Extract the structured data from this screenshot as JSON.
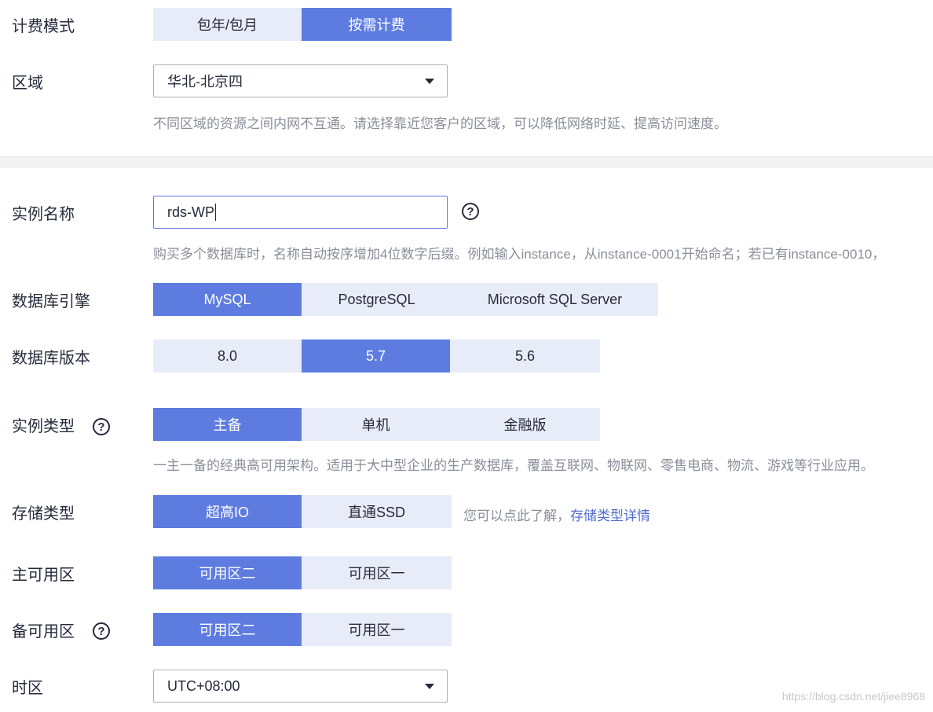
{
  "billing": {
    "label": "计费模式",
    "options": [
      "包年/包月",
      "按需计费"
    ],
    "selected": 1
  },
  "region": {
    "label": "区域",
    "value": "华北-北京四",
    "hint": "不同区域的资源之间内网不互通。请选择靠近您客户的区域，可以降低网络时延、提高访问速度。"
  },
  "instance_name": {
    "label": "实例名称",
    "value": "rds-WP",
    "hint": "购买多个数据库时，名称自动按序增加4位数字后缀。例如输入instance，从instance-0001开始命名；若已有instance-0010，"
  },
  "db_engine": {
    "label": "数据库引擎",
    "options": [
      "MySQL",
      "PostgreSQL",
      "Microsoft SQL Server"
    ],
    "selected": 0
  },
  "db_version": {
    "label": "数据库版本",
    "options": [
      "8.0",
      "5.7",
      "5.6"
    ],
    "selected": 1
  },
  "instance_type": {
    "label": "实例类型",
    "options": [
      "主备",
      "单机",
      "金融版"
    ],
    "selected": 0,
    "hint": "一主一备的经典高可用架构。适用于大中型企业的生产数据库，覆盖互联网、物联网、零售电商、物流、游戏等行业应用。"
  },
  "storage_type": {
    "label": "存储类型",
    "options": [
      "超高IO",
      "直通SSD"
    ],
    "selected": 0,
    "hint_prefix": "您可以点此了解，",
    "hint_link": "存储类型详情"
  },
  "primary_az": {
    "label": "主可用区",
    "options": [
      "可用区二",
      "可用区一"
    ],
    "selected": 0
  },
  "standby_az": {
    "label": "备可用区",
    "options": [
      "可用区二",
      "可用区一"
    ],
    "selected": 0
  },
  "timezone": {
    "label": "时区",
    "value": "UTC+08:00"
  },
  "watermark": "https://blog.csdn.net/jiee8968",
  "help_glyph": "?",
  "colors": {
    "accent": "#5e7ce0",
    "option_bg": "#e8ecf9",
    "hint_text": "#8a8e99",
    "link": "#526ecc"
  }
}
